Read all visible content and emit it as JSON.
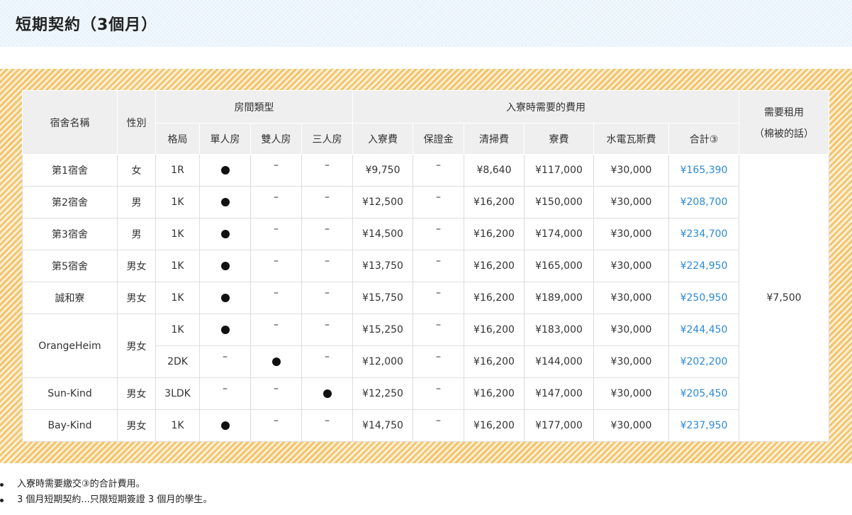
{
  "title": "短期契約（3個月）",
  "colors": {
    "total_text": "#2b8ad6",
    "stripe": "#f2c46e",
    "header_bg": "#efefef",
    "title_bg": "#e6f2fb"
  },
  "symbols": {
    "yes": "●",
    "no": "–"
  },
  "headers": {
    "name": "宿舍名稱",
    "gender": "性別",
    "room_type": "房間類型",
    "fees_group": "入寮時需要的費用",
    "bedding": "需要租用",
    "bedding_sub": "（棉被的話）",
    "layout": "格局",
    "single": "單人房",
    "double": "雙人房",
    "triple": "三人房",
    "entry_fee": "入寮費",
    "deposit": "保證金",
    "cleaning": "清掃費",
    "rent": "寮費",
    "utilities": "水電瓦斯費",
    "total": "合計③"
  },
  "bedding_fee": "¥7,500",
  "rows": [
    {
      "name": "第1宿舍",
      "gender": "女",
      "layout": "1R",
      "single": "●",
      "double": "–",
      "triple": "–",
      "entry_fee": "¥9,750",
      "deposit": "–",
      "cleaning": "¥8,640",
      "rent": "¥117,000",
      "utilities": "¥30,000",
      "total": "¥165,390"
    },
    {
      "name": "第2宿舍",
      "gender": "男",
      "layout": "1K",
      "single": "●",
      "double": "–",
      "triple": "–",
      "entry_fee": "¥12,500",
      "deposit": "–",
      "cleaning": "¥16,200",
      "rent": "¥150,000",
      "utilities": "¥30,000",
      "total": "¥208,700"
    },
    {
      "name": "第3宿舍",
      "gender": "男",
      "layout": "1K",
      "single": "●",
      "double": "–",
      "triple": "–",
      "entry_fee": "¥14,500",
      "deposit": "–",
      "cleaning": "¥16,200",
      "rent": "¥174,000",
      "utilities": "¥30,000",
      "total": "¥234,700"
    },
    {
      "name": "第5宿舍",
      "gender": "男女",
      "layout": "1K",
      "single": "●",
      "double": "–",
      "triple": "–",
      "entry_fee": "¥13,750",
      "deposit": "–",
      "cleaning": "¥16,200",
      "rent": "¥165,000",
      "utilities": "¥30,000",
      "total": "¥224,950"
    },
    {
      "name": "誠和寮",
      "gender": "男女",
      "layout": "1K",
      "single": "●",
      "double": "–",
      "triple": "–",
      "entry_fee": "¥15,750",
      "deposit": "–",
      "cleaning": "¥16,200",
      "rent": "¥189,000",
      "utilities": "¥30,000",
      "total": "¥250,950"
    },
    {
      "name": "OrangeHeim",
      "gender": "男女",
      "layout": "1K",
      "single": "●",
      "double": "–",
      "triple": "–",
      "entry_fee": "¥15,250",
      "deposit": "–",
      "cleaning": "¥16,200",
      "rent": "¥183,000",
      "utilities": "¥30,000",
      "total": "¥244,450"
    },
    {
      "layout": "2DK",
      "single": "–",
      "double": "●",
      "triple": "–",
      "entry_fee": "¥12,000",
      "deposit": "–",
      "cleaning": "¥16,200",
      "rent": "¥144,000",
      "utilities": "¥30,000",
      "total": "¥202,200"
    },
    {
      "name": "Sun-Kind",
      "gender": "男女",
      "layout": "3LDK",
      "single": "–",
      "double": "–",
      "triple": "●",
      "entry_fee": "¥12,250",
      "deposit": "–",
      "cleaning": "¥16,200",
      "rent": "¥147,000",
      "utilities": "¥30,000",
      "total": "¥205,450"
    },
    {
      "name": "Bay-Kind",
      "gender": "男女",
      "layout": "1K",
      "single": "●",
      "double": "–",
      "triple": "–",
      "entry_fee": "¥14,750",
      "deposit": "–",
      "cleaning": "¥16,200",
      "rent": "¥177,000",
      "utilities": "¥30,000",
      "total": "¥237,950"
    }
  ],
  "notes": [
    "入寮時需要繳交③的合計費用。",
    "3 個月短期契約...只限短期簽證 3 個月的學生。"
  ]
}
